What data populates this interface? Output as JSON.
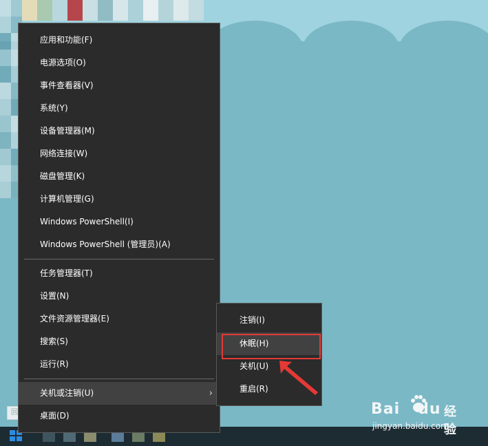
{
  "context_menu": {
    "items": [
      {
        "label": "应用和功能(F)"
      },
      {
        "label": "电源选项(O)"
      },
      {
        "label": "事件查看器(V)"
      },
      {
        "label": "系统(Y)"
      },
      {
        "label": "设备管理器(M)"
      },
      {
        "label": "网络连接(W)"
      },
      {
        "label": "磁盘管理(K)"
      },
      {
        "label": "计算机管理(G)"
      },
      {
        "label": "Windows PowerShell(I)"
      },
      {
        "label": "Windows PowerShell (管理员)(A)"
      },
      {
        "label": "任务管理器(T)"
      },
      {
        "label": "设置(N)"
      },
      {
        "label": "文件资源管理器(E)"
      },
      {
        "label": "搜索(S)"
      },
      {
        "label": "运行(R)"
      },
      {
        "label": "关机或注销(U)",
        "highlighted": true,
        "has_submenu": true
      },
      {
        "label": "桌面(D)"
      }
    ]
  },
  "submenu": {
    "items": [
      {
        "label": "注销(I)"
      },
      {
        "label": "休眠(H)",
        "highlighted": true
      },
      {
        "label": "关机(U)"
      },
      {
        "label": "重启(R)"
      }
    ]
  },
  "annotation": {
    "box_color": "#e53935",
    "arrow_color": "#e53935"
  },
  "watermark": {
    "logo": "Bai",
    "logo2": "du",
    "brand": "经验",
    "url": "jingyan.baidu.com"
  },
  "desktop": {
    "left_label": "回台"
  },
  "icons": {
    "submenu_arrow": "chevron-right-icon",
    "start": "windows-start-icon",
    "watermark_paw": "paw-icon"
  }
}
